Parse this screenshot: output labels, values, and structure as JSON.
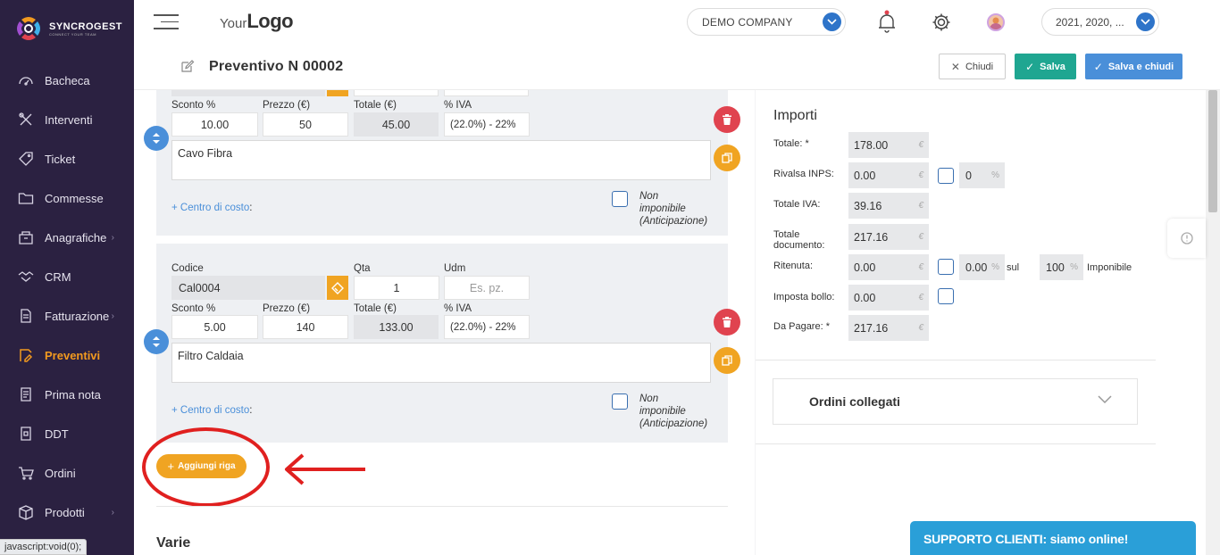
{
  "brand": {
    "name": "SYNCROGEST",
    "tagline": "CONNECT YOUR TEAM"
  },
  "sidebar": {
    "items": [
      {
        "label": "Bacheca",
        "icon": "dashboard-icon"
      },
      {
        "label": "Interventi",
        "icon": "tools-icon"
      },
      {
        "label": "Ticket",
        "icon": "tag-icon"
      },
      {
        "label": "Commesse",
        "icon": "folder-icon"
      },
      {
        "label": "Anagrafiche",
        "icon": "id-card-icon",
        "has_submenu": true
      },
      {
        "label": "CRM",
        "icon": "handshake-icon"
      },
      {
        "label": "Fatturazione",
        "icon": "document-icon",
        "has_submenu": true
      },
      {
        "label": "Preventivi",
        "icon": "quote-icon",
        "active": true
      },
      {
        "label": "Prima nota",
        "icon": "note-icon"
      },
      {
        "label": "DDT",
        "icon": "ddt-icon"
      },
      {
        "label": "Ordini",
        "icon": "cart-icon"
      },
      {
        "label": "Prodotti",
        "icon": "box-icon",
        "has_submenu": true
      }
    ]
  },
  "topbar": {
    "logo_pre": "Your",
    "logo_main": "Logo",
    "company": "DEMO COMPANY",
    "years": "2021, 2020, ..."
  },
  "header": {
    "title": "Preventivo N 00002",
    "close_label": "Chiudi",
    "save_label": "Salva",
    "save_close_label": "Salva e chiudi"
  },
  "rows": [
    {
      "sconto_label": "Sconto %",
      "sconto": "10.00",
      "prezzo_label": "Prezzo (€)",
      "prezzo": "50",
      "totale_label": "Totale (€)",
      "totale": "45.00",
      "iva_label": "% IVA",
      "iva": "(22.0%) - 22%",
      "descrizione": "Cavo Fibra",
      "cdc_label": "+ Centro di costo",
      "cdc_colon": ":",
      "non_imp_1": "Non",
      "non_imp_2": "imponibile",
      "non_imp_3": "(Anticipazione)"
    },
    {
      "codice_label": "Codice",
      "codice": "Cal0004",
      "qta_label": "Qta",
      "qta": "1",
      "udm_label": "Udm",
      "udm_placeholder": "Es. pz.",
      "sconto_label": "Sconto %",
      "sconto": "5.00",
      "prezzo_label": "Prezzo (€)",
      "prezzo": "140",
      "totale_label": "Totale (€)",
      "totale": "133.00",
      "iva_label": "% IVA",
      "iva": "(22.0%) - 22%",
      "descrizione": "Filtro Caldaia",
      "cdc_label": "+ Centro di costo",
      "cdc_colon": ":",
      "non_imp_1": "Non",
      "non_imp_2": "imponibile",
      "non_imp_3": "(Anticipazione)"
    }
  ],
  "add_row_label": "Aggiungi riga",
  "varie_title": "Varie",
  "importi": {
    "title": "Importi",
    "currency": "€",
    "percent": "%",
    "totale_label": "Totale: *",
    "totale": "178.00",
    "rivalsa_label": "Rivalsa INPS:",
    "rivalsa": "0.00",
    "rivalsa_pct": "0",
    "totale_iva_label": "Totale IVA:",
    "totale_iva": "39.16",
    "totale_doc_label_1": "Totale",
    "totale_doc_label_2": "documento:",
    "totale_doc": "217.16",
    "ritenuta_label": "Ritenuta:",
    "ritenuta": "0.00",
    "ritenuta_pct": "0.00",
    "sul_label": "sul",
    "imponibile_pct": "100",
    "imponibile_label": "Imponibile",
    "bollo_label": "Imposta bollo:",
    "bollo": "0.00",
    "da_pagare_label": "Da Pagare: *",
    "da_pagare": "217.16"
  },
  "ordini_collegati_label": "Ordini collegati",
  "support_label": "SUPPORTO CLIENTI: siamo online!",
  "status_url": "javascript:void(0);",
  "colors": {
    "sidebar": "#2b2141",
    "active": "#f29a1f",
    "teal": "#1fa691",
    "blue": "#4a8fd9",
    "orange": "#f0a422",
    "red": "#e0434f"
  }
}
